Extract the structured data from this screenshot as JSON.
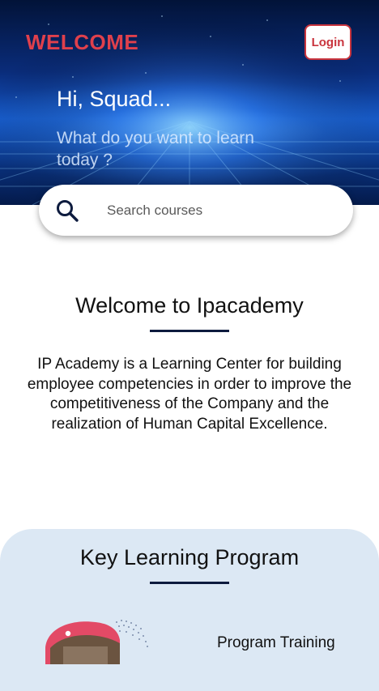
{
  "header": {
    "logo_text": "WELCOME",
    "login_label": "Login",
    "greeting": "Hi, Squad...",
    "subtitle": "What do you want to learn today ?"
  },
  "search": {
    "placeholder": "Search courses"
  },
  "welcome_section": {
    "title": "Welcome to Ipacademy",
    "description": "IP Academy is a Learning Center for building employee competencies in order to improve the competitiveness of the Company and the realization of Human Capital Excellence."
  },
  "key_learning": {
    "title": "Key Learning Program",
    "program_label": "Program Training"
  },
  "colors": {
    "accent_red": "#e0404c",
    "underline_navy": "#0d1b3e",
    "section_bg": "#dce8f4"
  },
  "icons": {
    "search": "search-icon"
  }
}
